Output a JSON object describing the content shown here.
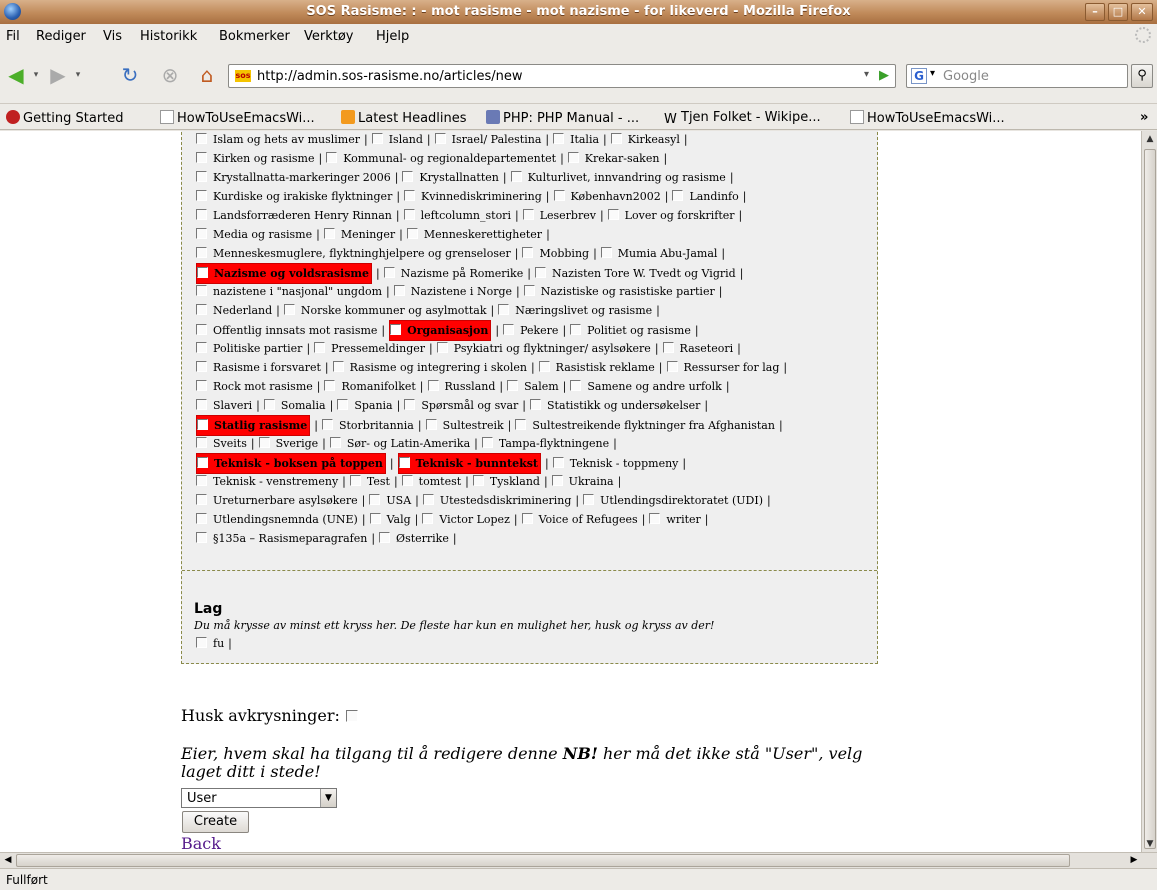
{
  "window": {
    "title": "SOS Rasisme: : - mot rasisme - mot nazisme - for likeverd - Mozilla Firefox"
  },
  "menu": [
    "Fil",
    "Rediger",
    "Vis",
    "Historikk",
    "Bokmerker",
    "Verktøy",
    "Hjelp"
  ],
  "nav": {
    "url": "http://admin.sos-rasisme.no/articles/new",
    "search_placeholder": "Google",
    "favicon_text": "sos"
  },
  "bookmarks": [
    "Getting Started",
    "HowToUseEmacsWi...",
    "Latest Headlines",
    "PHP: PHP Manual - ...",
    "Tjen Folket - Wikipe...",
    "HowToUseEmacsWi..."
  ],
  "bookmarks_overflow": "»",
  "categories": [
    [
      {
        "t": "Islam og hets av muslimer"
      },
      {
        "t": "Island"
      },
      {
        "t": "Israel/ Palestina"
      },
      {
        "t": "Italia"
      },
      {
        "t": "Kirkeasyl"
      }
    ],
    [
      {
        "t": "Kirken og rasisme"
      },
      {
        "t": "Kommunal- og regionaldepartementet"
      },
      {
        "t": "Krekar-saken"
      }
    ],
    [
      {
        "t": "Krystallnatta-markeringer 2006"
      },
      {
        "t": "Krystallnatten"
      },
      {
        "t": "Kulturlivet, innvandring og rasisme"
      }
    ],
    [
      {
        "t": "Kurdiske og irakiske flyktninger"
      },
      {
        "t": "Kvinnediskriminering"
      },
      {
        "t": "København2002"
      },
      {
        "t": "Landinfo"
      }
    ],
    [
      {
        "t": "Landsforræderen Henry Rinnan"
      },
      {
        "t": "leftcolumn_stori"
      },
      {
        "t": "Leserbrev"
      },
      {
        "t": "Lover og forskrifter"
      }
    ],
    [
      {
        "t": "Media og rasisme"
      },
      {
        "t": "Meninger"
      },
      {
        "t": "Menneskerettigheter"
      }
    ],
    [
      {
        "t": "Menneskesmuglere, flyktninghjelpere og grenseloser"
      },
      {
        "t": "Mobbing"
      },
      {
        "t": "Mumia Abu-Jamal"
      }
    ],
    [
      {
        "t": "Nazisme og voldsrasisme",
        "hl": true
      },
      {
        "t": "Nazisme på Romerike"
      },
      {
        "t": "Nazisten Tore W. Tvedt og Vigrid"
      }
    ],
    [
      {
        "t": "nazistene i \"nasjonal\" ungdom"
      },
      {
        "t": "Nazistene i Norge"
      },
      {
        "t": "Nazistiske og rasistiske partier"
      }
    ],
    [
      {
        "t": "Nederland"
      },
      {
        "t": "Norske kommuner og asylmottak"
      },
      {
        "t": "Næringslivet og rasisme"
      }
    ],
    [
      {
        "t": "Offentlig innsats mot rasisme"
      },
      {
        "t": "Organisasjon",
        "hl": true
      },
      {
        "t": "Pekere"
      },
      {
        "t": "Politiet og rasisme"
      }
    ],
    [
      {
        "t": "Politiske partier"
      },
      {
        "t": "Pressemeldinger"
      },
      {
        "t": "Psykiatri og flyktninger/ asylsøkere"
      },
      {
        "t": "Raseteori"
      }
    ],
    [
      {
        "t": "Rasisme i forsvaret"
      },
      {
        "t": "Rasisme og integrering i skolen"
      },
      {
        "t": "Rasistisk reklame"
      },
      {
        "t": "Ressurser for lag"
      }
    ],
    [
      {
        "t": "Rock mot rasisme"
      },
      {
        "t": "Romanifolket"
      },
      {
        "t": "Russland"
      },
      {
        "t": "Salem"
      },
      {
        "t": "Samene og andre urfolk"
      }
    ],
    [
      {
        "t": "Slaveri"
      },
      {
        "t": "Somalia"
      },
      {
        "t": "Spania"
      },
      {
        "t": "Spørsmål og svar"
      },
      {
        "t": "Statistikk og undersøkelser"
      }
    ],
    [
      {
        "t": "Statlig rasisme",
        "hl": true
      },
      {
        "t": "Storbritannia"
      },
      {
        "t": "Sultestreik"
      },
      {
        "t": "Sultestreikende flyktninger fra Afghanistan"
      }
    ],
    [
      {
        "t": "Sveits"
      },
      {
        "t": "Sverige"
      },
      {
        "t": "Sør- og Latin-Amerika"
      },
      {
        "t": "Tampa-flyktningene"
      }
    ],
    [
      {
        "t": "Teknisk - boksen på toppen",
        "hl": true
      },
      {
        "t": "Teknisk - bunntekst",
        "hl": true
      },
      {
        "t": "Teknisk - toppmeny"
      }
    ],
    [
      {
        "t": "Teknisk - venstremeny"
      },
      {
        "t": "Test"
      },
      {
        "t": "tomtest"
      },
      {
        "t": "Tyskland"
      },
      {
        "t": "Ukraina"
      }
    ],
    [
      {
        "t": "Ureturnerbare asylsøkere"
      },
      {
        "t": "USA"
      },
      {
        "t": "Utestedsdiskriminering"
      },
      {
        "t": "Utlendingsdirektoratet (UDI)"
      }
    ],
    [
      {
        "t": "Utlendingsnemnda (UNE)"
      },
      {
        "t": "Valg"
      },
      {
        "t": "Victor Lopez"
      },
      {
        "t": "Voice of Refugees"
      },
      {
        "t": "writer"
      }
    ],
    [
      {
        "t": "§135a – Rasismeparagrafen"
      },
      {
        "t": "Østerrike"
      }
    ]
  ],
  "lag": {
    "title": "Lag",
    "note": "Du må krysse av minst ett kryss her. De fleste har kun en mulighet her, husk og kryss av der!",
    "items": [
      "fu"
    ]
  },
  "form": {
    "husk_label": "Husk avkrysninger:",
    "eier_pre": "Eier, hvem skal ha tilgang til å redigere denne ",
    "eier_nb": "NB!",
    "eier_post": " her må det ikke stå \"User\", velg laget ditt i stede!",
    "owner_value": "User",
    "create_label": "Create",
    "back_label": "Back"
  },
  "status": "Fullført",
  "colors": {
    "highlight": "#ff0000",
    "link_visited": "#551a8b",
    "titlebar": "#c08a5a"
  }
}
